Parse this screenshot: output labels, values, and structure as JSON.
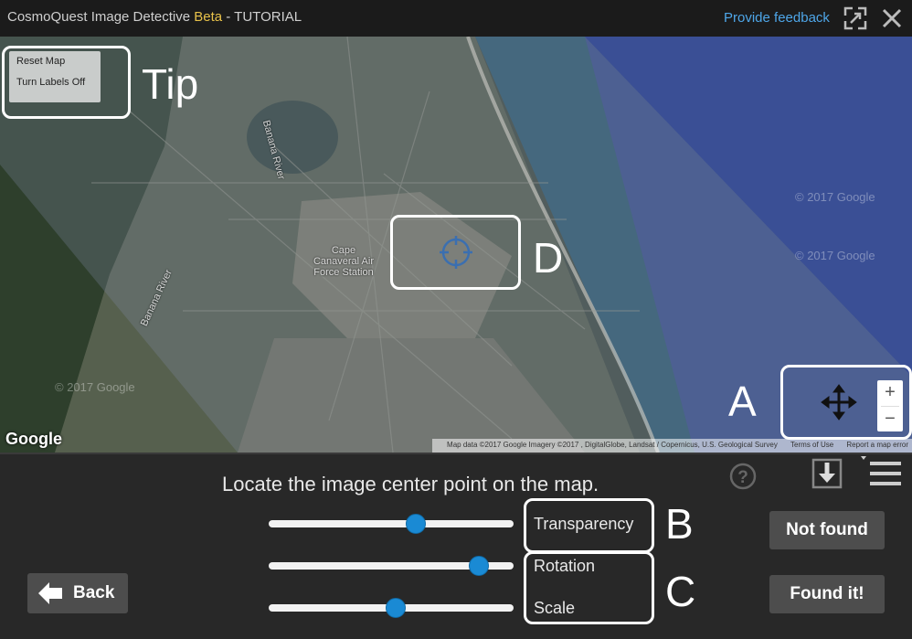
{
  "titlebar": {
    "app_name": "CosmoQuest Image Detective",
    "beta": "Beta",
    "suffix": " - TUTORIAL",
    "feedback_link": "Provide feedback",
    "icons": [
      "expand-icon",
      "close-icon"
    ]
  },
  "map": {
    "controls": {
      "reset": "Reset Map",
      "labels_off": "Turn Labels Off"
    },
    "place_labels": {
      "station": "Cape\nCanaveral Air\nForce Station",
      "banana_river_1": "Banana River",
      "banana_river_2": "Banana River"
    },
    "watermarks": [
      "© 2017 Google",
      "© 2017 Google",
      "© 2017 Google"
    ],
    "google_logo": "Google",
    "attribution": {
      "data": "Map data ©2017 Google Imagery ©2017 , DigitalGlobe, Landsat / Copernicus, U.S. Geological Survey",
      "terms": "Terms of Use",
      "report": "Report a map error"
    },
    "zoom": {
      "in": "+",
      "out": "−"
    }
  },
  "callouts": {
    "tip": "Tip",
    "a": "A",
    "b": "B",
    "c": "C",
    "d": "D"
  },
  "panel": {
    "instruction": "Locate the image center point on the map.",
    "sliders": {
      "transparency": {
        "label": "Transparency",
        "value": 0.6
      },
      "rotation": {
        "label": "Rotation",
        "value": 0.86
      },
      "scale": {
        "label": "Scale",
        "value": 0.52
      }
    },
    "buttons": {
      "back": "Back",
      "not_found": "Not found",
      "found": "Found it!"
    }
  },
  "colors": {
    "accent": "#1a8ad4",
    "link": "#4ea6e8",
    "beta": "#e8c24a",
    "button_bg": "#4d4d4d"
  }
}
